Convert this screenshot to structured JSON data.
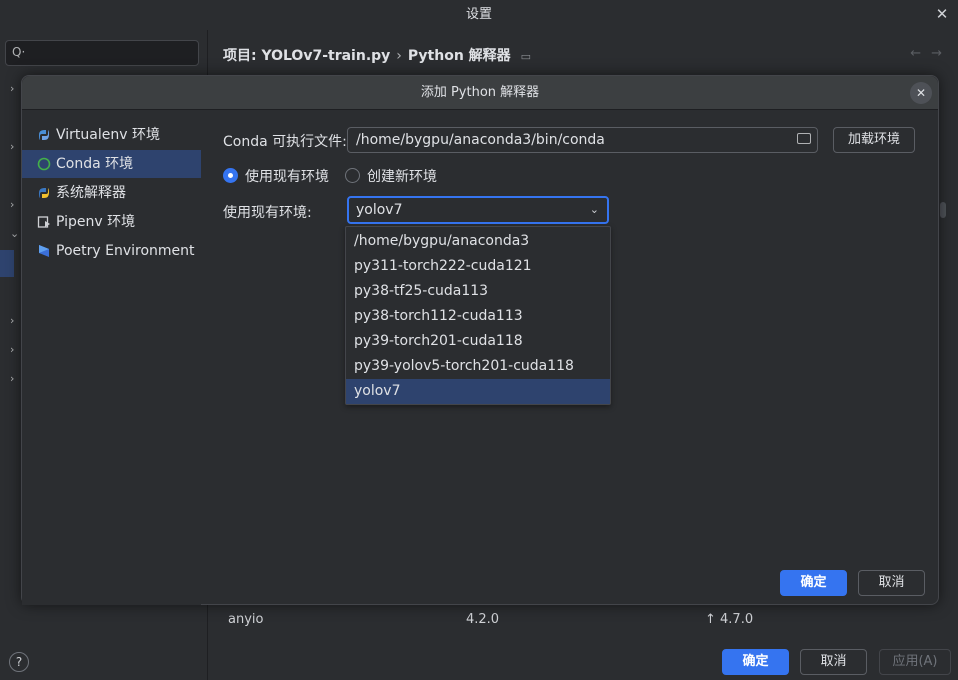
{
  "window": {
    "title": "设置",
    "close_label": "✕"
  },
  "settings": {
    "search_placeholder": "",
    "breadcrumb": {
      "project": "项目: YOLOv7-train.py",
      "separator": "›",
      "page": "Python 解释器"
    },
    "package_row": {
      "name": "anyio",
      "version": "4.2.0",
      "latest": "↑ 4.7.0"
    },
    "help_label": "?",
    "buttons": {
      "ok": "确定",
      "cancel": "取消",
      "apply": "应用(A)"
    }
  },
  "dialog": {
    "title": "添加 Python 解释器",
    "close_label": "✕",
    "sidebar": [
      {
        "label": "Virtualenv 环境",
        "icon": "virtualenv-icon"
      },
      {
        "label": "Conda 环境",
        "icon": "conda-icon"
      },
      {
        "label": "系统解释器",
        "icon": "python-icon"
      },
      {
        "label": "Pipenv 环境",
        "icon": "pipenv-icon"
      },
      {
        "label": "Poetry Environment",
        "icon": "poetry-icon"
      }
    ],
    "conda_label": "Conda 可执行文件:",
    "conda_path": "/home/bygpu/anaconda3/bin/conda",
    "load_env_button": "加载环境",
    "radio_existing": "使用现有环境",
    "radio_new": "创建新环境",
    "existing_env_label": "使用现有环境:",
    "selected_env": "yolov7",
    "env_options": [
      "/home/bygpu/anaconda3",
      "py311-torch222-cuda121",
      "py38-tf25-cuda113",
      "py38-torch112-cuda113",
      "py39-torch201-cuda118",
      "py39-yolov5-torch201-cuda118",
      "yolov7"
    ],
    "buttons": {
      "ok": "确定",
      "cancel": "取消"
    }
  },
  "colors": {
    "accent": "#3574f0",
    "selection": "#2e436e",
    "background": "#2b2d30"
  }
}
